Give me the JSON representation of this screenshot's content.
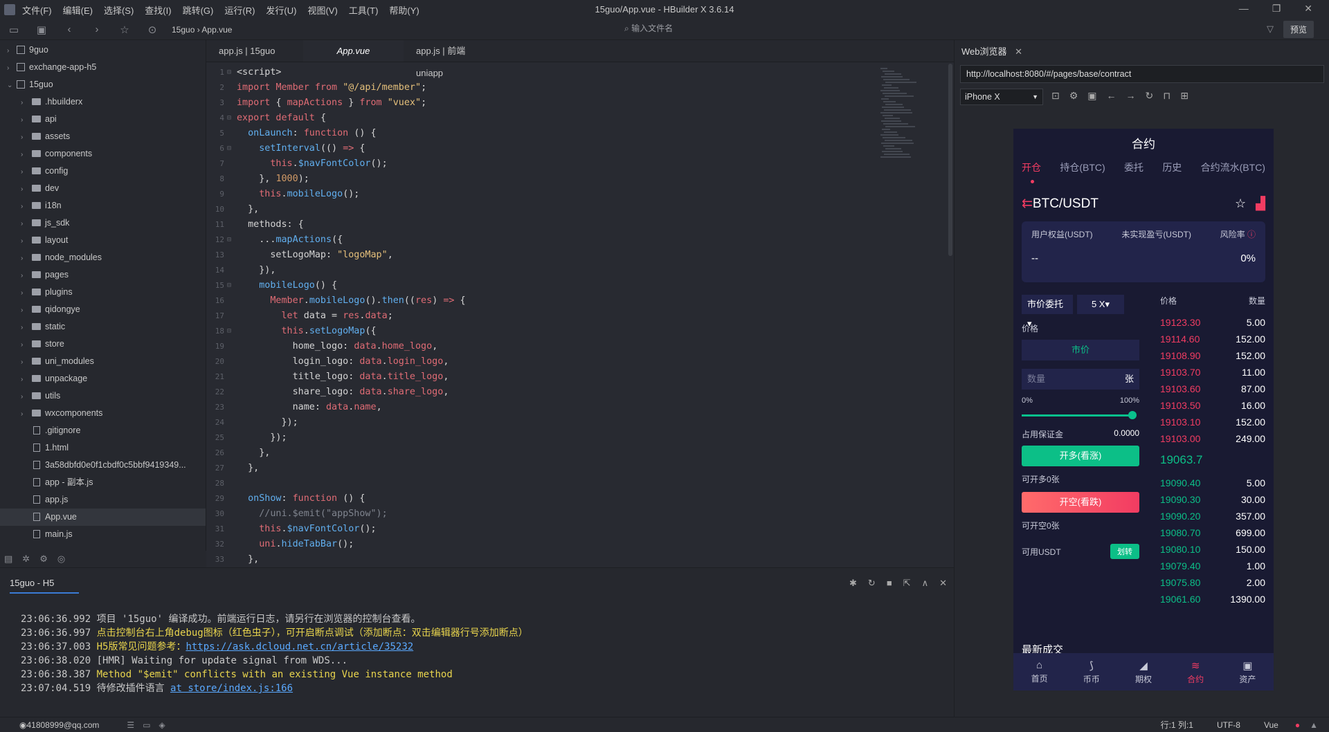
{
  "window": {
    "title": "15guo/App.vue - HBuilder X 3.6.14"
  },
  "menu": [
    "文件(F)",
    "编辑(E)",
    "选择(S)",
    "查找(I)",
    "跳转(G)",
    "运行(R)",
    "发行(U)",
    "视图(V)",
    "工具(T)",
    "帮助(Y)"
  ],
  "toolbar": {
    "crumb_project": "15guo",
    "crumb_file": "App.vue",
    "search_placeholder": "输入文件名",
    "preview_label": "预览"
  },
  "sidebar": {
    "items": [
      {
        "label": "9guo",
        "type": "project",
        "depth": 0,
        "arrow": "›"
      },
      {
        "label": "exchange-app-h5",
        "type": "project",
        "depth": 0,
        "arrow": "›"
      },
      {
        "label": "15guo",
        "type": "project",
        "depth": 0,
        "arrow": "⌄"
      },
      {
        "label": ".hbuilderx",
        "type": "folder",
        "depth": 1
      },
      {
        "label": "api",
        "type": "folder",
        "depth": 1
      },
      {
        "label": "assets",
        "type": "folder",
        "depth": 1
      },
      {
        "label": "components",
        "type": "folder",
        "depth": 1
      },
      {
        "label": "config",
        "type": "folder",
        "depth": 1
      },
      {
        "label": "dev",
        "type": "folder",
        "depth": 1
      },
      {
        "label": "i18n",
        "type": "folder",
        "depth": 1
      },
      {
        "label": "js_sdk",
        "type": "folder",
        "depth": 1
      },
      {
        "label": "layout",
        "type": "folder",
        "depth": 1
      },
      {
        "label": "node_modules",
        "type": "folder",
        "depth": 1
      },
      {
        "label": "pages",
        "type": "folder",
        "depth": 1
      },
      {
        "label": "plugins",
        "type": "folder",
        "depth": 1
      },
      {
        "label": "qidongye",
        "type": "folder",
        "depth": 1
      },
      {
        "label": "static",
        "type": "folder",
        "depth": 1
      },
      {
        "label": "store",
        "type": "folder",
        "depth": 1
      },
      {
        "label": "uni_modules",
        "type": "folder",
        "depth": 1
      },
      {
        "label": "unpackage",
        "type": "folder",
        "depth": 1
      },
      {
        "label": "utils",
        "type": "folder",
        "depth": 1
      },
      {
        "label": "wxcomponents",
        "type": "folder",
        "depth": 1
      },
      {
        "label": ".gitignore",
        "type": "file",
        "depth": 1
      },
      {
        "label": "1.html",
        "type": "file",
        "depth": 1
      },
      {
        "label": "3a58dbfd0e0f1cbdf0c5bbf9419349...",
        "type": "file",
        "depth": 1
      },
      {
        "label": "app - 副本.js",
        "type": "file",
        "depth": 1
      },
      {
        "label": "app.js",
        "type": "file",
        "depth": 1
      },
      {
        "label": "App.vue",
        "type": "file",
        "depth": 1,
        "selected": true
      },
      {
        "label": "main.js",
        "type": "file",
        "depth": 1
      }
    ]
  },
  "editor": {
    "tabs": [
      {
        "label": "app.js | 15guo"
      },
      {
        "label": "App.vue",
        "active": true
      },
      {
        "label": "app.js | 前端uniapp"
      }
    ],
    "lines": [
      {
        "n": "1",
        "f": "⊟",
        "t": [
          [
            "pu",
            "<script>"
          ]
        ]
      },
      {
        "n": "2",
        "t": [
          [
            "kw",
            "import "
          ],
          [
            "pr",
            "Member "
          ],
          [
            "kw",
            "from "
          ],
          [
            "st",
            "\"@/api/member\""
          ],
          [
            "pu",
            ";"
          ]
        ]
      },
      {
        "n": "3",
        "t": [
          [
            "kw",
            "import "
          ],
          [
            "pu",
            "{ "
          ],
          [
            "pr",
            "mapActions "
          ],
          [
            "pu",
            "} "
          ],
          [
            "kw",
            "from "
          ],
          [
            "st",
            "\"vuex\""
          ],
          [
            "pu",
            ";"
          ]
        ]
      },
      {
        "n": "4",
        "f": "⊟",
        "t": [
          [
            "kw",
            "export default "
          ],
          [
            "pu",
            "{"
          ]
        ]
      },
      {
        "n": "5",
        "t": [
          [
            "pu",
            "  "
          ],
          [
            "fn",
            "onLaunch"
          ],
          [
            "pu",
            ": "
          ],
          [
            "kw",
            "function "
          ],
          [
            "pu",
            "() {"
          ]
        ]
      },
      {
        "n": "6",
        "f": "⊟",
        "t": [
          [
            "pu",
            "    "
          ],
          [
            "fn",
            "setInterval"
          ],
          [
            "pu",
            "(() "
          ],
          [
            "kw",
            "=> "
          ],
          [
            "pu",
            "{"
          ]
        ]
      },
      {
        "n": "7",
        "t": [
          [
            "pu",
            "      "
          ],
          [
            "kw",
            "this"
          ],
          [
            "pu",
            "."
          ],
          [
            "fn",
            "$navFontColor"
          ],
          [
            "pu",
            "();"
          ]
        ]
      },
      {
        "n": "8",
        "t": [
          [
            "pu",
            "    }, "
          ],
          [
            "nm",
            "1000"
          ],
          [
            "pu",
            ");"
          ]
        ]
      },
      {
        "n": "9",
        "t": [
          [
            "pu",
            "    "
          ],
          [
            "kw",
            "this"
          ],
          [
            "pu",
            "."
          ],
          [
            "fn",
            "mobileLogo"
          ],
          [
            "pu",
            "();"
          ]
        ]
      },
      {
        "n": "10",
        "t": [
          [
            "pu",
            "  },"
          ]
        ]
      },
      {
        "n": "11",
        "t": [
          [
            "pu",
            "  methods: {"
          ]
        ]
      },
      {
        "n": "12",
        "f": "⊟",
        "t": [
          [
            "pu",
            "    ..."
          ],
          [
            "fn",
            "mapActions"
          ],
          [
            "pu",
            "({"
          ]
        ]
      },
      {
        "n": "13",
        "t": [
          [
            "pu",
            "      setLogoMap: "
          ],
          [
            "st",
            "\"logoMap\""
          ],
          [
            "pu",
            ","
          ]
        ]
      },
      {
        "n": "14",
        "t": [
          [
            "pu",
            "    }),"
          ]
        ]
      },
      {
        "n": "15",
        "f": "⊟",
        "t": [
          [
            "pu",
            "    "
          ],
          [
            "fn",
            "mobileLogo"
          ],
          [
            "pu",
            "() {"
          ]
        ]
      },
      {
        "n": "16",
        "t": [
          [
            "pu",
            "      "
          ],
          [
            "pr",
            "Member"
          ],
          [
            "pu",
            "."
          ],
          [
            "fn",
            "mobileLogo"
          ],
          [
            "pu",
            "()."
          ],
          [
            "fn",
            "then"
          ],
          [
            "pu",
            "(("
          ],
          [
            "pr",
            "res"
          ],
          [
            "pu",
            ") "
          ],
          [
            "kw",
            "=> "
          ],
          [
            "pu",
            "{"
          ]
        ]
      },
      {
        "n": "17",
        "t": [
          [
            "pu",
            "        "
          ],
          [
            "kw",
            "let "
          ],
          [
            "pu",
            "data = "
          ],
          [
            "pr",
            "res"
          ],
          [
            "pu",
            "."
          ],
          [
            "pr",
            "data"
          ],
          [
            "pu",
            ";"
          ]
        ]
      },
      {
        "n": "18",
        "f": "⊟",
        "t": [
          [
            "pu",
            "        "
          ],
          [
            "kw",
            "this"
          ],
          [
            "pu",
            "."
          ],
          [
            "fn",
            "setLogoMap"
          ],
          [
            "pu",
            "({"
          ]
        ]
      },
      {
        "n": "19",
        "t": [
          [
            "pu",
            "          home_logo: "
          ],
          [
            "pr",
            "data"
          ],
          [
            "pu",
            "."
          ],
          [
            "pr",
            "home_logo"
          ],
          [
            "pu",
            ","
          ]
        ]
      },
      {
        "n": "20",
        "t": [
          [
            "pu",
            "          login_logo: "
          ],
          [
            "pr",
            "data"
          ],
          [
            "pu",
            "."
          ],
          [
            "pr",
            "login_logo"
          ],
          [
            "pu",
            ","
          ]
        ]
      },
      {
        "n": "21",
        "t": [
          [
            "pu",
            "          title_logo: "
          ],
          [
            "pr",
            "data"
          ],
          [
            "pu",
            "."
          ],
          [
            "pr",
            "title_logo"
          ],
          [
            "pu",
            ","
          ]
        ]
      },
      {
        "n": "22",
        "t": [
          [
            "pu",
            "          share_logo: "
          ],
          [
            "pr",
            "data"
          ],
          [
            "pu",
            "."
          ],
          [
            "pr",
            "share_logo"
          ],
          [
            "pu",
            ","
          ]
        ]
      },
      {
        "n": "23",
        "t": [
          [
            "pu",
            "          name: "
          ],
          [
            "pr",
            "data"
          ],
          [
            "pu",
            "."
          ],
          [
            "pr",
            "name"
          ],
          [
            "pu",
            ","
          ]
        ]
      },
      {
        "n": "24",
        "t": [
          [
            "pu",
            "        });"
          ]
        ]
      },
      {
        "n": "25",
        "t": [
          [
            "pu",
            "      });"
          ]
        ]
      },
      {
        "n": "26",
        "t": [
          [
            "pu",
            "    },"
          ]
        ]
      },
      {
        "n": "27",
        "t": [
          [
            "pu",
            "  },"
          ]
        ]
      },
      {
        "n": "28",
        "t": [
          [
            "pu",
            ""
          ]
        ]
      },
      {
        "n": "29",
        "t": [
          [
            "pu",
            "  "
          ],
          [
            "fn",
            "onShow"
          ],
          [
            "pu",
            ": "
          ],
          [
            "kw",
            "function "
          ],
          [
            "pu",
            "() {"
          ]
        ]
      },
      {
        "n": "30",
        "t": [
          [
            "cm",
            "    //uni.$emit(\"appShow\");"
          ]
        ]
      },
      {
        "n": "31",
        "t": [
          [
            "pu",
            "    "
          ],
          [
            "kw",
            "this"
          ],
          [
            "pu",
            "."
          ],
          [
            "fn",
            "$navFontColor"
          ],
          [
            "pu",
            "();"
          ]
        ]
      },
      {
        "n": "32",
        "t": [
          [
            "pu",
            "    "
          ],
          [
            "pr",
            "uni"
          ],
          [
            "pu",
            "."
          ],
          [
            "fn",
            "hideTabBar"
          ],
          [
            "pu",
            "();"
          ]
        ]
      },
      {
        "n": "33",
        "t": [
          [
            "pu",
            "  },"
          ]
        ]
      }
    ]
  },
  "console": {
    "tab": "15guo - H5",
    "lines": [
      {
        "time": "23:06:36.992",
        "parts": [
          [
            "tm",
            "项目 '15guo' 编译成功。前端运行日志，请另行在浏览器的控制台查看。"
          ]
        ]
      },
      {
        "time": "23:06:36.997",
        "parts": [
          [
            "w",
            "点击控制台右上角debug图标（红色虫子），可开启断点调试（添加断点：双击编辑器行号添加断点）"
          ]
        ]
      },
      {
        "time": "23:06:37.003",
        "parts": [
          [
            "w",
            "H5版常见问题参考："
          ],
          [
            "lk",
            "https://ask.dcloud.net.cn/article/35232"
          ]
        ]
      },
      {
        "time": "23:06:38.020",
        "parts": [
          [
            "tm",
            "[HMR] Waiting for update signal from WDS..."
          ]
        ]
      },
      {
        "time": "23:06:38.387",
        "parts": [
          [
            "w",
            "Method \"$emit\" conflicts with an existing Vue instance method"
          ]
        ]
      },
      {
        "time": "23:07:04.519",
        "parts": [
          [
            "tm",
            "待修改插件语言  "
          ],
          [
            "lk",
            "at store/index.js:166"
          ]
        ]
      }
    ]
  },
  "status": {
    "user": "41808999@qq.com",
    "position": "行:1  列:1",
    "encoding": "UTF-8",
    "language": "Vue"
  },
  "browser": {
    "tab": "Web浏览器",
    "url": "http://localhost:8080/#/pages/base/contract",
    "device": "iPhone X"
  },
  "phone": {
    "title": "合约",
    "tabs": [
      "开仓",
      "持仓(BTC)",
      "委托",
      "历史",
      "合约流水(BTC)"
    ],
    "pair": "BTC/USDT",
    "acct_labels": [
      "用户权益(USDT)",
      "未实现盈亏(USDT)",
      "风险率"
    ],
    "acct_values": [
      "--",
      "0%"
    ],
    "order_type": "市价委托",
    "leverage": "5 X",
    "price_label": "价格",
    "price_value": "市价",
    "qty_placeholder": "数量",
    "qty_unit": "张",
    "pct_min": "0%",
    "pct_max": "100%",
    "margin_label": "占用保证金",
    "margin_value": "0.0000",
    "buy_label": "开多(看涨)",
    "can_long": "可开多0张",
    "sell_label": "开空(看跌)",
    "can_short": "可开空0张",
    "avail_label": "可用USDT",
    "transfer_label": "划转",
    "ob_price_h": "价格",
    "ob_qty_h": "数量",
    "asks": [
      [
        "19123.30",
        "5.00"
      ],
      [
        "19114.60",
        "152.00"
      ],
      [
        "19108.90",
        "152.00"
      ],
      [
        "19103.70",
        "11.00"
      ],
      [
        "19103.60",
        "87.00"
      ],
      [
        "19103.50",
        "16.00"
      ],
      [
        "19103.10",
        "152.00"
      ],
      [
        "19103.00",
        "249.00"
      ]
    ],
    "last_price": "19063.7",
    "bids": [
      [
        "19090.40",
        "5.00"
      ],
      [
        "19090.30",
        "30.00"
      ],
      [
        "19090.20",
        "357.00"
      ],
      [
        "19080.70",
        "699.00"
      ],
      [
        "19080.10",
        "150.00"
      ],
      [
        "19079.40",
        "1.00"
      ],
      [
        "19075.80",
        "2.00"
      ],
      [
        "19061.60",
        "1390.00"
      ]
    ],
    "recent_trades": "最新成交",
    "tabbar": [
      "首页",
      "币币",
      "期权",
      "合约",
      "资产"
    ]
  }
}
